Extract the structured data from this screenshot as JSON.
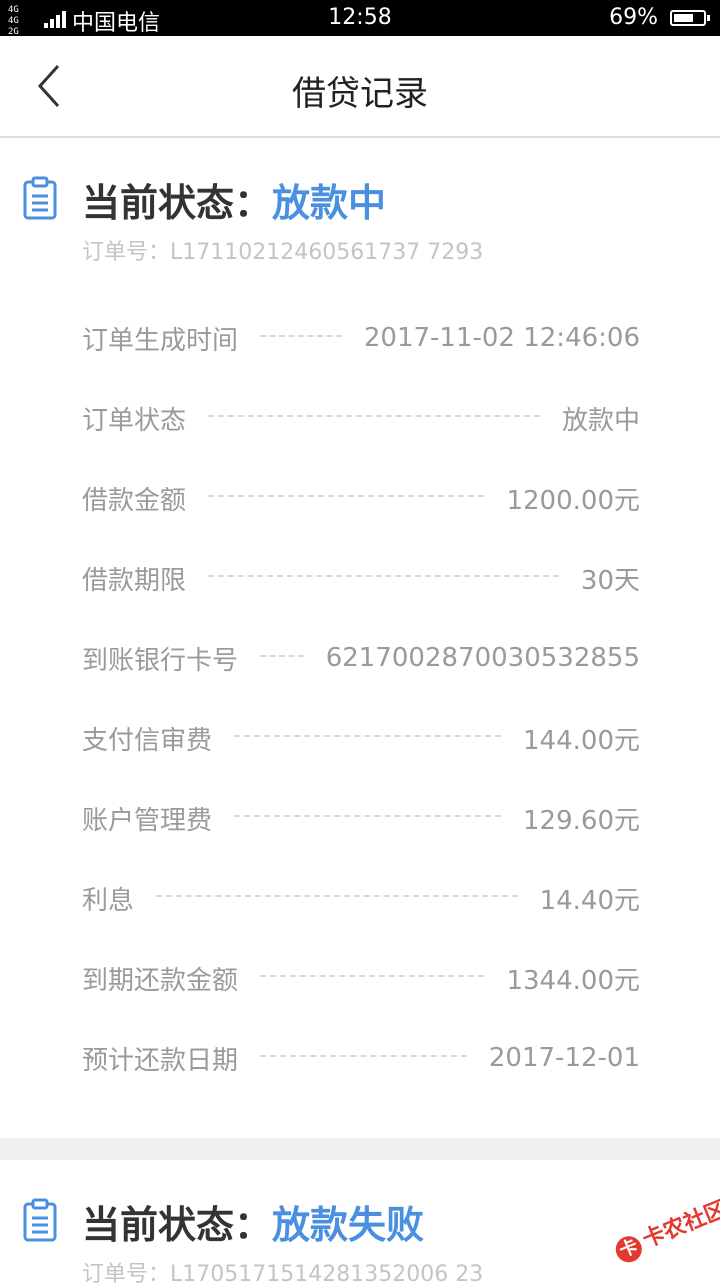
{
  "status_bar": {
    "network_top": "4G 4G",
    "network_bottom": "2G",
    "carrier": "中国电信",
    "time": "12:58",
    "battery_pct": "69%",
    "battery_level": 0.69
  },
  "header": {
    "title": "借贷记录",
    "back_icon": "chevron-left-icon"
  },
  "orders": [
    {
      "status_label": "当前状态：",
      "status_value": "放款中",
      "order_no": "订单号：L17110212460561737 7293",
      "rows": [
        {
          "label": "订单生成时间",
          "value": "2017-11-02 12:46:06"
        },
        {
          "label": "订单状态",
          "value": "放款中"
        },
        {
          "label": "借款金额",
          "value": "1200.00元"
        },
        {
          "label": "借款期限",
          "value": "30天"
        },
        {
          "label": "到账银行卡号",
          "value": "6217002870030532855"
        },
        {
          "label": "支付信审费",
          "value": "144.00元"
        },
        {
          "label": "账户管理费",
          "value": "129.60元"
        },
        {
          "label": "利息",
          "value": "14.40元"
        },
        {
          "label": "到期还款金额",
          "value": "1344.00元"
        },
        {
          "label": "预计还款日期",
          "value": "2017-12-01"
        }
      ]
    },
    {
      "status_label": "当前状态：",
      "status_value": "放款失败",
      "order_no": "订单号：L1705171514281352006 23"
    }
  ],
  "watermark": {
    "logo_char": "卡",
    "text": "卡农社区"
  },
  "colors": {
    "accent": "#4a8fe0",
    "label_gray": "#9a9a9a",
    "divider": "#dcdcdc"
  }
}
